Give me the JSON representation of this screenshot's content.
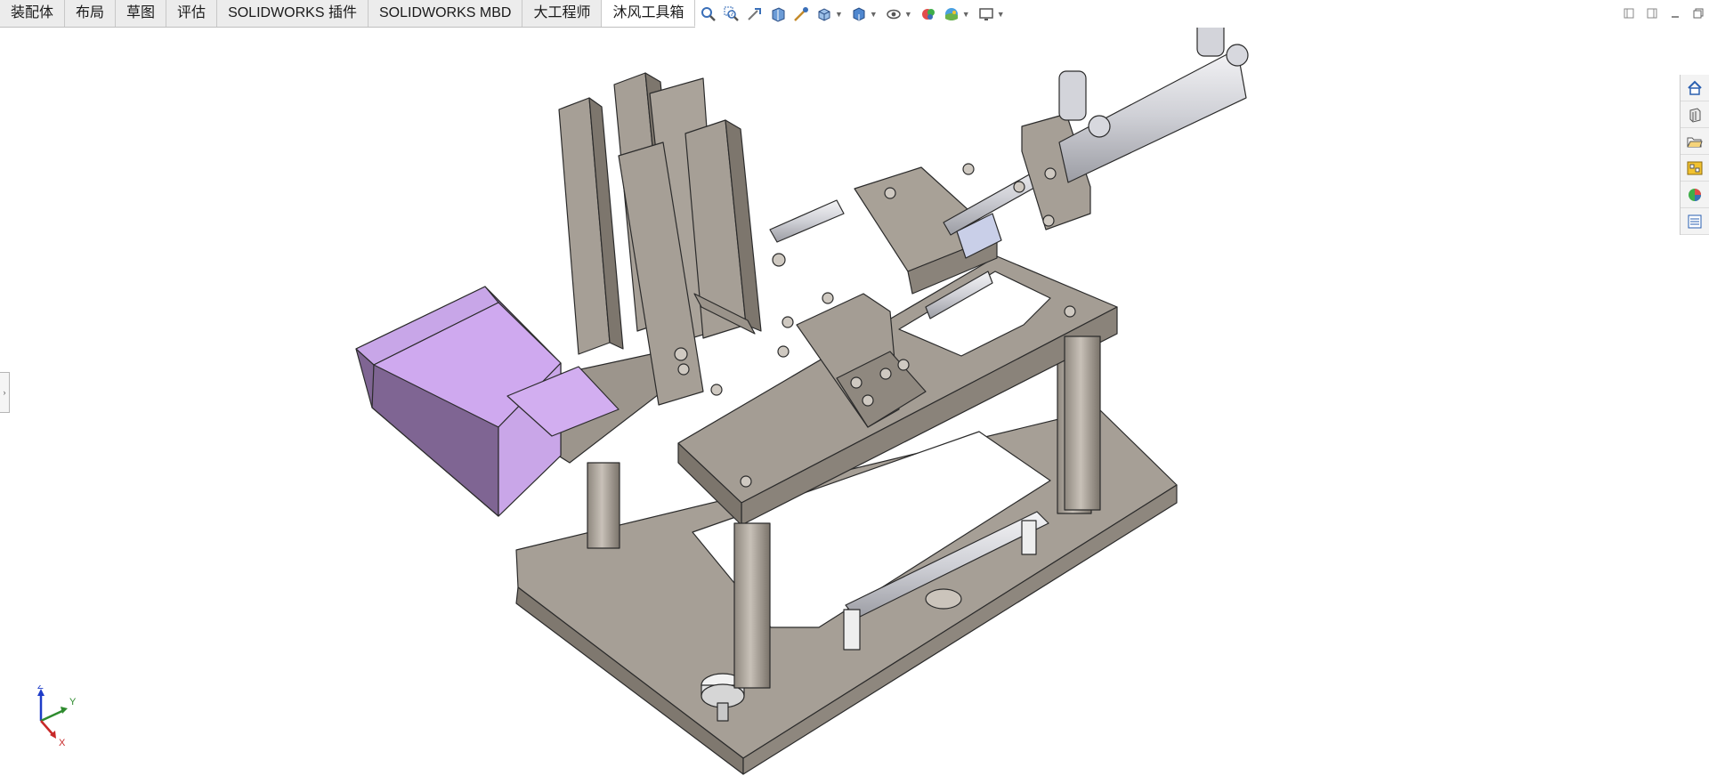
{
  "tabs": [
    {
      "label": "装配体",
      "active": false
    },
    {
      "label": "布局",
      "active": false
    },
    {
      "label": "草图",
      "active": false
    },
    {
      "label": "评估",
      "active": false
    },
    {
      "label": "SOLIDWORKS 插件",
      "active": false
    },
    {
      "label": "SOLIDWORKS MBD",
      "active": false
    },
    {
      "label": "大工程师",
      "active": false
    },
    {
      "label": "沐风工具箱",
      "active": true
    }
  ],
  "hud_toolbar": {
    "icons": [
      "zoom-to-fit-icon",
      "zoom-to-area-icon",
      "previous-view-icon",
      "section-view-icon",
      "dynamic-annotation-icon",
      "view-orientation-icon",
      "display-style-icon",
      "hide-show-items-icon",
      "edit-appearance-icon",
      "apply-scene-icon",
      "view-settings-icon"
    ]
  },
  "window_controls": [
    "tile-left-icon",
    "tile-right-icon",
    "minimize-icon",
    "restore-icon"
  ],
  "task_pane": [
    "home-icon",
    "design-library-icon",
    "file-explorer-icon",
    "view-palette-icon",
    "appearances-icon",
    "custom-properties-icon"
  ],
  "triad": {
    "x": "X",
    "y": "Y",
    "z": "Z"
  },
  "colors": {
    "metal": "#a49d94",
    "metal_dark": "#7d766d",
    "tray": "#c9a6e8",
    "accent_blue": "#2a5fb0"
  }
}
